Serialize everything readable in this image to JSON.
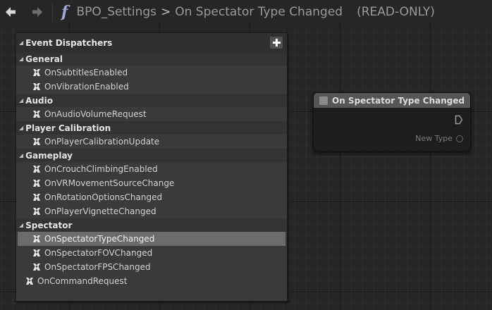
{
  "breadcrumb": {
    "blueprint": "BPO_Settings",
    "separator": ">",
    "function": "On Spectator Type Changed",
    "mode": "(READ-ONLY)"
  },
  "icons": {
    "back": "back-arrow-icon",
    "forward": "forward-arrow-icon",
    "function": "function-icon",
    "function_glyph": "f",
    "dispatcher": "event-dispatcher-icon",
    "add": "plus-icon"
  },
  "panel": {
    "title": "Event Dispatchers",
    "add_label": "+",
    "categories": [
      {
        "name": "General",
        "items": [
          "OnSubtitlesEnabled",
          "OnVibrationEnabled"
        ]
      },
      {
        "name": "Audio",
        "items": [
          "OnAudioVolumeRequest"
        ]
      },
      {
        "name": "Player Calibration",
        "items": [
          "OnPlayerCalibrationUpdate"
        ]
      },
      {
        "name": "Gameplay",
        "items": [
          "OnCrouchClimbingEnabled",
          "OnVRMovementSourceChange",
          "OnRotationOptionsChanged",
          "OnPlayerVignetteChanged"
        ]
      },
      {
        "name": "Spectator",
        "items": [
          "OnSpectatorTypeChanged",
          "OnSpectatorFOVChanged",
          "OnSpectatorFPSChanged"
        ]
      }
    ],
    "uncategorized": [
      "OnCommandRequest"
    ],
    "selected": "OnSpectatorTypeChanged"
  },
  "node": {
    "title": "On Spectator Type Changed",
    "pin_label": "New Type"
  },
  "colors": {
    "background": "#262626",
    "selection": "#6b6b6b",
    "dispatcher_icon": "#e8e8e8",
    "function_icon": "#9aa9d8"
  }
}
